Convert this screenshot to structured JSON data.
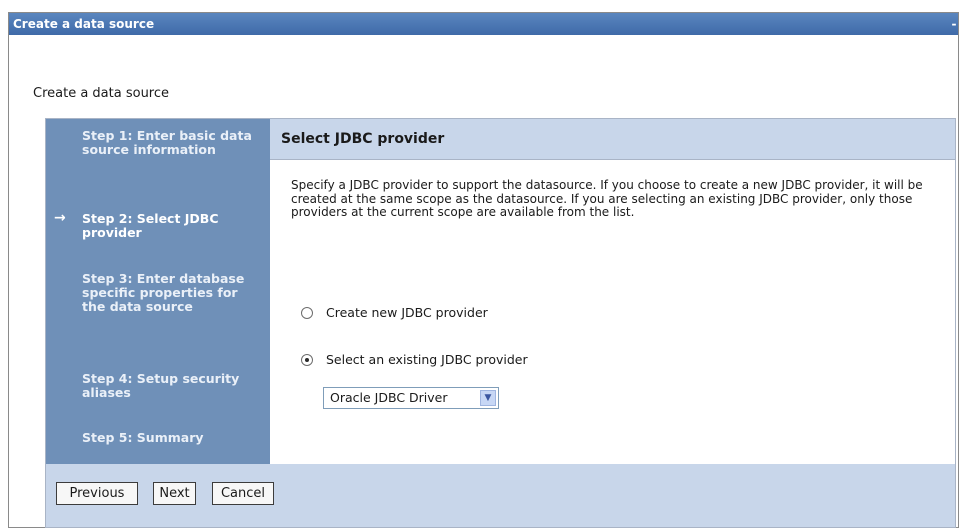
{
  "window": {
    "title": "Create a data source"
  },
  "page": {
    "heading": "Create a data source"
  },
  "steps": [
    {
      "label": "Step 1: Enter basic data source information",
      "current": false
    },
    {
      "label": "Step 2: Select JDBC provider",
      "current": true
    },
    {
      "label": "Step 3: Enter database specific properties for the data source",
      "current": false
    },
    {
      "label": "Step 4: Setup security aliases",
      "current": false
    },
    {
      "label": "Step 5: Summary",
      "current": false
    }
  ],
  "current_step_marker": "→",
  "content": {
    "title": "Select JDBC provider",
    "description": "Specify a JDBC provider to support the datasource. If you choose to create a new JDBC provider, it will be created at the same scope as the datasource. If you are selecting an existing JDBC provider, only those providers at the current scope are available from the list.",
    "options": [
      {
        "label": "Create new JDBC provider",
        "checked": false
      },
      {
        "label": "Select an existing JDBC provider",
        "checked": true
      }
    ],
    "provider_select": {
      "value": "Oracle JDBC Driver"
    }
  },
  "buttons": {
    "previous": "Previous",
    "next": "Next",
    "cancel": "Cancel"
  },
  "colors": {
    "titlebar": "#4a76b2",
    "step_panel": "#6f90b8",
    "header_band": "#c8d6ea"
  }
}
